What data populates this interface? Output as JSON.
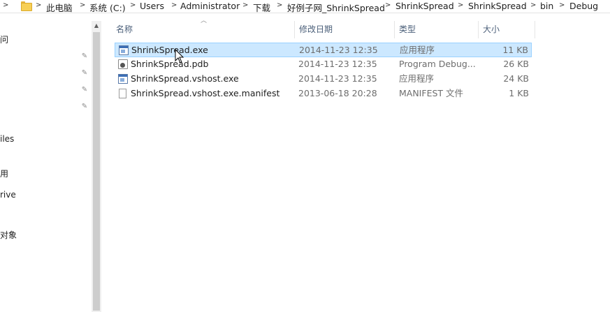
{
  "breadcrumb": {
    "items": [
      "此电脑",
      "系统 (C:)",
      "Users",
      "Administrator",
      "下载",
      "好例子网_ShrinkSpread",
      "ShrinkSpread",
      "ShrinkSpread",
      "bin",
      "Debug"
    ],
    "separator": ">"
  },
  "nav": {
    "fragments": [
      "问",
      "iles",
      "用",
      "rive",
      "对象"
    ],
    "pin_glyph": "✎"
  },
  "columns": {
    "name": "名称",
    "date": "修改日期",
    "type": "类型",
    "size": "大小"
  },
  "files": [
    {
      "name": "ShrinkSpread.exe",
      "date": "2014-11-23 12:35",
      "type": "应用程序",
      "size": "11 KB",
      "icon": "exe-file-icon",
      "selected": true
    },
    {
      "name": "ShrinkSpread.pdb",
      "date": "2014-11-23 12:35",
      "type": "Program Debug...",
      "size": "26 KB",
      "icon": "pdb-file-icon",
      "selected": false
    },
    {
      "name": "ShrinkSpread.vshost.exe",
      "date": "2014-11-23 12:35",
      "type": "应用程序",
      "size": "24 KB",
      "icon": "exe-file-icon",
      "selected": false
    },
    {
      "name": "ShrinkSpread.vshost.exe.manifest",
      "date": "2013-06-18 20:28",
      "type": "MANIFEST 文件",
      "size": "1 KB",
      "icon": "manifest-file-icon",
      "selected": false
    }
  ],
  "colors": {
    "selection_bg": "#cce8ff",
    "selection_border": "#99d1ff",
    "header_text": "#4c607a",
    "folder_yellow": "#f7cf55"
  }
}
